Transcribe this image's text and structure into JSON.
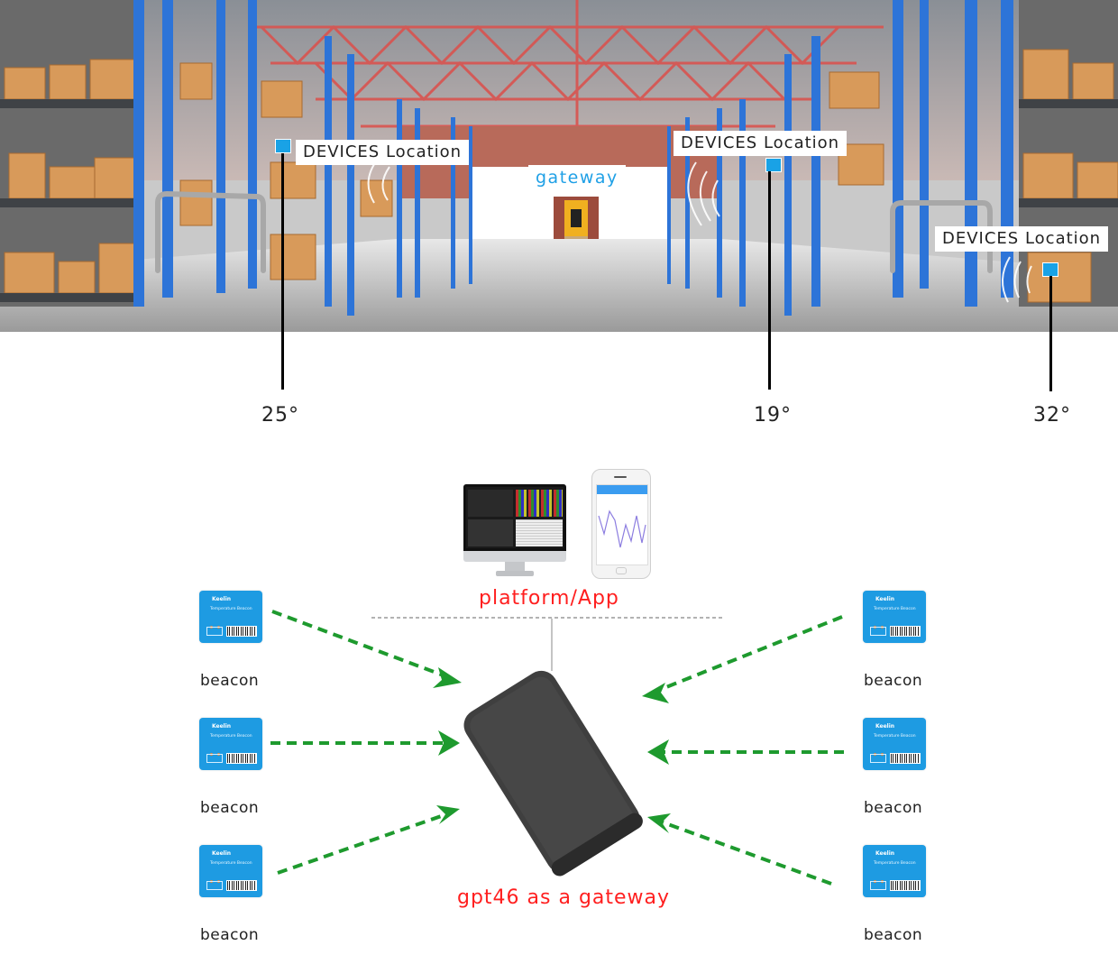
{
  "scene": {
    "labels": {
      "device_location_1": "DEVICES Location",
      "device_location_2": "DEVICES Location",
      "device_location_3": "DEVICES Location",
      "gateway": "gateway"
    },
    "temperatures": [
      "25°",
      "19°",
      "32°"
    ]
  },
  "diagram": {
    "platform_label": "platform/App",
    "gateway_label": "gpt46 as a gateway",
    "beacon_brand": "Keelin",
    "beacon_model": "Temperature Beacon",
    "beacons_left": [
      {
        "label": "beacon"
      },
      {
        "label": "beacon"
      },
      {
        "label": "beacon"
      }
    ],
    "beacons_right": [
      {
        "label": "beacon"
      },
      {
        "label": "beacon"
      },
      {
        "label": "beacon"
      }
    ]
  },
  "colors": {
    "accent_blue": "#1fa0e6",
    "label_red": "#ff1f1f",
    "arrow_green": "#1e9a2e",
    "beacon_blue": "#1e9be2"
  }
}
